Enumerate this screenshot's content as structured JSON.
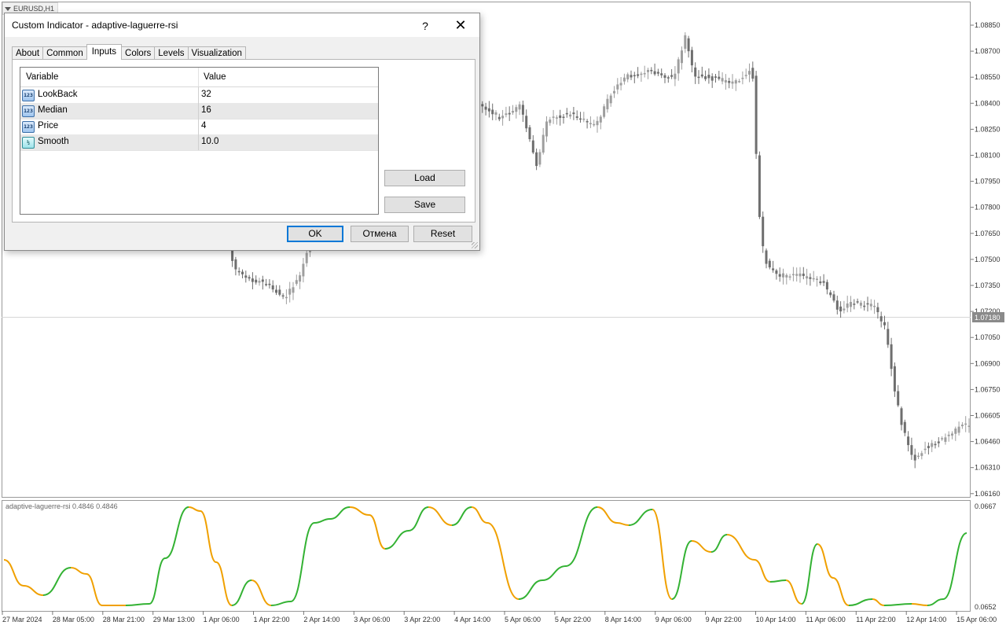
{
  "chart": {
    "symbol": "EURUSD,H1",
    "price_labels": [
      "1.08850",
      "1.08700",
      "1.08550",
      "1.08400",
      "1.08250",
      "1.08100",
      "1.07950",
      "1.07800",
      "1.07650",
      "1.07500",
      "1.07350",
      "1.07200",
      "1.07050",
      "1.06900",
      "1.06750",
      "1.06605",
      "1.06460",
      "1.06310",
      "1.06160"
    ],
    "current_price": "1.07180",
    "date_labels": [
      "27 Mar 2024",
      "28 Mar 05:00",
      "28 Mar 21:00",
      "29 Mar 13:00",
      "1 Apr 06:00",
      "1 Apr 22:00",
      "2 Apr 14:00",
      "3 Apr 06:00",
      "3 Apr 22:00",
      "4 Apr 14:00",
      "5 Apr 06:00",
      "5 Apr 22:00",
      "8 Apr 14:00",
      "9 Apr 06:00",
      "9 Apr 22:00",
      "10 Apr 14:00",
      "11 Apr 06:00",
      "11 Apr 22:00",
      "12 Apr 14:00",
      "15 Apr 06:00"
    ],
    "colors": {
      "candle": "#9e9e9e",
      "candle_dark": "#6e6e6e",
      "rsi_up": "#33b233",
      "rsi_down": "#f0a000",
      "axis": "#333333"
    }
  },
  "indicator": {
    "label": "adaptive-laguerre-rsi 0.4846 0.4846",
    "scale_top": "0.0667",
    "scale_bottom": "0.0652"
  },
  "dialog": {
    "title": "Custom Indicator - adaptive-laguerre-rsi",
    "help": "?",
    "close": "✕",
    "tabs": [
      {
        "label": "About"
      },
      {
        "label": "Common"
      },
      {
        "label": "Inputs",
        "active": true
      },
      {
        "label": "Colors"
      },
      {
        "label": "Levels"
      },
      {
        "label": "Visualization"
      }
    ],
    "table": {
      "col_variable": "Variable",
      "col_value": "Value",
      "rows": [
        {
          "icon": "int-icon",
          "icon_text": "123",
          "variable": "LookBack",
          "value": "32"
        },
        {
          "icon": "int-icon",
          "icon_text": "123",
          "variable": "Median",
          "value": "16"
        },
        {
          "icon": "int-icon",
          "icon_text": "123",
          "variable": "Price",
          "value": "4"
        },
        {
          "icon": "double-icon",
          "icon_text": "½",
          "variable": "Smooth",
          "value": "10.0"
        }
      ]
    },
    "buttons": {
      "load": "Load",
      "save": "Save",
      "ok": "OK",
      "cancel": "Отмена",
      "reset": "Reset"
    }
  }
}
